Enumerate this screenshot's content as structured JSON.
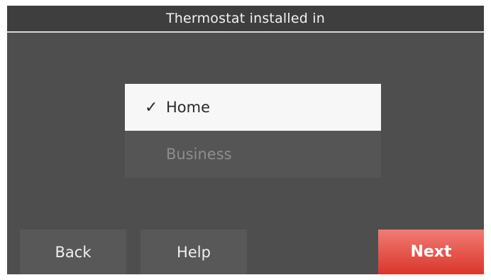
{
  "header": {
    "title": "Thermostat installed in"
  },
  "options": [
    {
      "label": "Home",
      "selected": true
    },
    {
      "label": "Business",
      "selected": false
    }
  ],
  "icons": {
    "selected_marker": "✓"
  },
  "buttons": {
    "back_label": "Back",
    "help_label": "Help",
    "next_label": "Next"
  },
  "colors": {
    "screen_background": "#4e4e4e",
    "selected_option": "#f7f7f7",
    "next_button": "#e0463d"
  }
}
